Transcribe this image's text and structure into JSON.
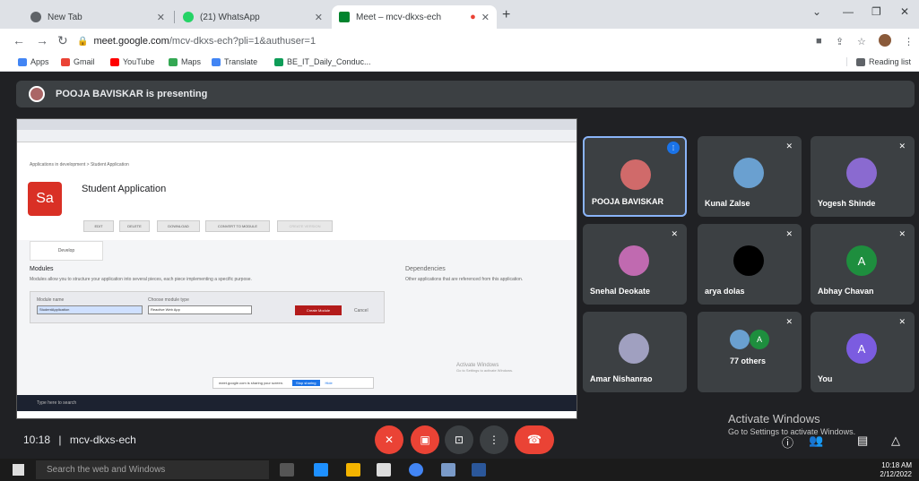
{
  "browser": {
    "tabs": [
      {
        "label": "New Tab",
        "favicon_color": "#5f6368"
      },
      {
        "label": "(21) WhatsApp",
        "favicon_color": "#25d366"
      },
      {
        "label": "Meet – mcv-dkxs-ech",
        "favicon_color": "#00832d"
      }
    ],
    "url_host": "meet.google.com",
    "url_path": "/mcv-dkxs-ech?pli=1&authuser=1",
    "bookmarks": [
      "Apps",
      "Gmail",
      "YouTube",
      "Maps",
      "Translate",
      "BE_IT_Daily_Conduc..."
    ],
    "reading_list": "Reading list"
  },
  "meet": {
    "presenting_text": "POOJA BAVISKAR is presenting",
    "meeting_time": "10:18",
    "meeting_code": "mcv-dkxs-ech",
    "participants": [
      {
        "name": "POOJA BAVISKAR",
        "avatar_color": "#d06a6a"
      },
      {
        "name": "Kunal Zalse",
        "avatar_color": "#6aa0d0"
      },
      {
        "name": "Yogesh Shinde",
        "avatar_color": "#8a6ad0"
      },
      {
        "name": "Snehal Deokate",
        "avatar_color": "#c06ab0"
      },
      {
        "name": "arya dolas",
        "avatar_color": "#000000"
      },
      {
        "name": "Abhay Chavan",
        "avatar_letter": "A",
        "avatar_color": "#1e8e3e"
      },
      {
        "name": "Amar Nishanrao",
        "avatar_color": "#a0a0c0"
      },
      {
        "name": "77 others",
        "avatar_letter": "A",
        "avatar_color": "#1e8e3e"
      },
      {
        "name": "You",
        "avatar_letter": "A",
        "avatar_color": "#7b5ce0"
      }
    ],
    "activate_title": "Activate Windows",
    "activate_sub": "Go to Settings to activate Windows."
  },
  "shared_screen": {
    "app_title": "Student Application",
    "logo_text": "Sa",
    "breadcrumb": "Applications in development > Student Application",
    "buttons": [
      "EDIT",
      "DELETE",
      "DOWNLOAD",
      "CONVERT TO MODULE",
      "CREATE VERSION"
    ],
    "develop_tab": "Develop",
    "modules_heading": "Modules",
    "modules_desc": "Modules allow you to structure your application into several pieces, each piece implementing a specific purpose.",
    "dependencies_heading": "Dependencies",
    "dependencies_desc": "Other applications that are referenced from this application.",
    "module_name_label": "Module name",
    "module_name_value": "StudentApplication",
    "module_type_label": "Choose module type",
    "module_type_value": "Reactive Web App",
    "create_module": "Create Module",
    "cancel": "Cancel",
    "share_notice": "meet.google.com is sharing your screen.",
    "stop_sharing": "Stop sharing",
    "hide": "Hide",
    "inner_search": "Type here to search",
    "inner_activate": "Activate Windows",
    "inner_activate_sub": "Go to Settings to activate Windows."
  },
  "taskbar": {
    "search_placeholder": "Search the web and Windows",
    "time": "10:18 AM",
    "date": "2/12/2022"
  }
}
